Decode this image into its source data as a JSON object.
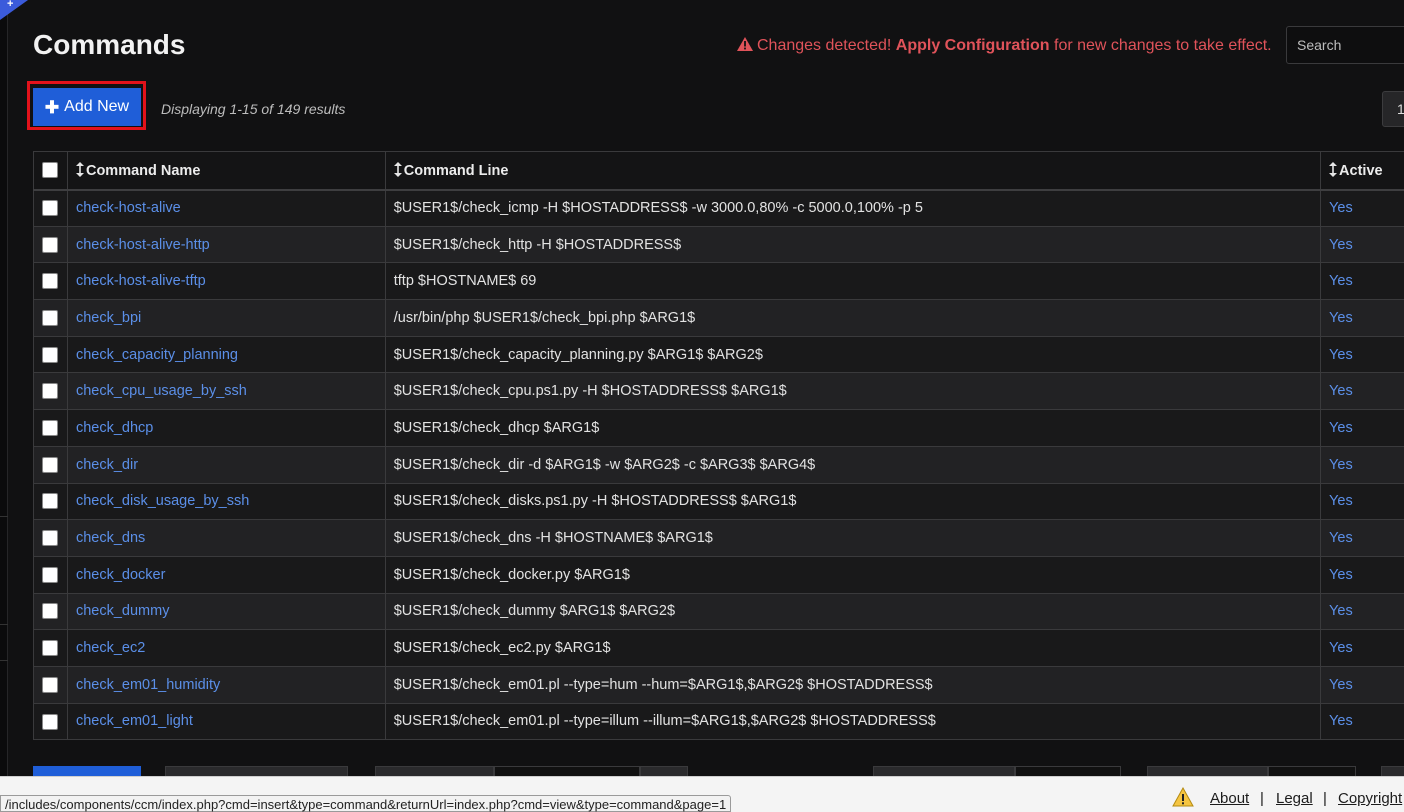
{
  "corner_tab": {
    "symbol": "+"
  },
  "header": {
    "title": "Commands",
    "alert": {
      "prefix": "Changes detected!",
      "link": "Apply Configuration",
      "suffix": "for new changes to take effect.",
      "color": "#e0535a"
    },
    "search_placeholder": "Search"
  },
  "toolbar": {
    "add_label": "Add New",
    "display_count": "Displaying 1-15 of 149 results",
    "page_value": "1"
  },
  "table": {
    "headers": {
      "name": "Command Name",
      "line": "Command Line",
      "active": "Active"
    },
    "rows": [
      {
        "name": "check-host-alive",
        "line": "$USER1$/check_icmp -H $HOSTADDRESS$ -w 3000.0,80% -c 5000.0,100% -p 5",
        "active": "Yes"
      },
      {
        "name": "check-host-alive-http",
        "line": "$USER1$/check_http -H $HOSTADDRESS$",
        "active": "Yes"
      },
      {
        "name": "check-host-alive-tftp",
        "line": "tftp $HOSTNAME$ 69",
        "active": "Yes"
      },
      {
        "name": "check_bpi",
        "line": "/usr/bin/php $USER1$/check_bpi.php $ARG1$",
        "active": "Yes"
      },
      {
        "name": "check_capacity_planning",
        "line": "$USER1$/check_capacity_planning.py $ARG1$ $ARG2$",
        "active": "Yes"
      },
      {
        "name": "check_cpu_usage_by_ssh",
        "line": "$USER1$/check_cpu.ps1.py -H $HOSTADDRESS$ $ARG1$",
        "active": "Yes"
      },
      {
        "name": "check_dhcp",
        "line": "$USER1$/check_dhcp $ARG1$",
        "active": "Yes"
      },
      {
        "name": "check_dir",
        "line": "$USER1$/check_dir -d $ARG1$ -w $ARG2$ -c $ARG3$ $ARG4$",
        "active": "Yes"
      },
      {
        "name": "check_disk_usage_by_ssh",
        "line": "$USER1$/check_disks.ps1.py -H $HOSTADDRESS$ $ARG1$",
        "active": "Yes"
      },
      {
        "name": "check_dns",
        "line": "$USER1$/check_dns -H $HOSTNAME$ $ARG1$",
        "active": "Yes"
      },
      {
        "name": "check_docker",
        "line": "$USER1$/check_docker.py $ARG1$",
        "active": "Yes"
      },
      {
        "name": "check_dummy",
        "line": "$USER1$/check_dummy $ARG1$ $ARG2$",
        "active": "Yes"
      },
      {
        "name": "check_ec2",
        "line": "$USER1$/check_ec2.py $ARG1$",
        "active": "Yes"
      },
      {
        "name": "check_em01_humidity",
        "line": "$USER1$/check_em01.pl --type=hum --hum=$ARG1$,$ARG2$ $HOSTADDRESS$",
        "active": "Yes"
      },
      {
        "name": "check_em01_light",
        "line": "$USER1$/check_em01.pl --type=illum --illum=$ARG1$,$ARG2$ $HOSTADDRESS$",
        "active": "Yes"
      }
    ]
  },
  "footer": {
    "links": [
      "About",
      "Legal",
      "Copyright"
    ],
    "separator": "|"
  },
  "status_url": "/includes/components/ccm/index.php?cmd=insert&type=command&returnUrl=index.php?cmd=view&type=command&page=1",
  "colors": {
    "accent": "#1f5ed8",
    "link": "#5b8fe8",
    "alert": "#e0535a",
    "highlight_border": "#e2121b"
  }
}
